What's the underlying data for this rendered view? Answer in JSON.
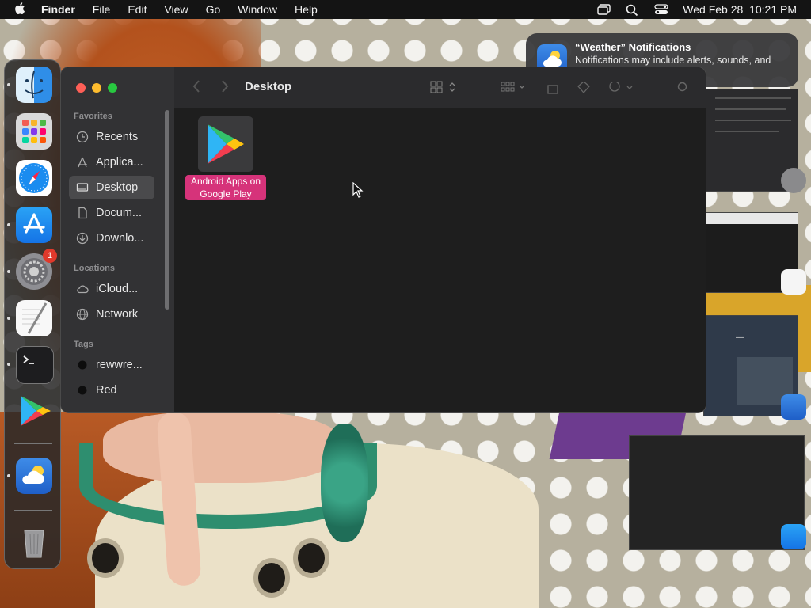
{
  "menubar": {
    "app_name": "Finder",
    "items": [
      "File",
      "Edit",
      "View",
      "Go",
      "Window",
      "Help"
    ],
    "datetime": "Wed Feb 28  10:21 PM"
  },
  "notification": {
    "title": "“Weather” Notifications",
    "body": "Notifications may include alerts, sounds, and icon badges."
  },
  "dock": {
    "apps": [
      {
        "name": "Finder",
        "icon": "finder-icon",
        "running": true
      },
      {
        "name": "Launchpad",
        "icon": "launchpad-icon",
        "running": false
      },
      {
        "name": "Safari",
        "icon": "safari-icon",
        "running": false
      },
      {
        "name": "App Store",
        "icon": "app-store-icon",
        "running": true
      },
      {
        "name": "System Settings",
        "icon": "system-settings-icon",
        "running": true,
        "badge": "1"
      },
      {
        "name": "TextEdit",
        "icon": "textedit-icon",
        "running": true
      },
      {
        "name": "Terminal",
        "icon": "terminal-icon",
        "running": true
      },
      {
        "name": "Google Play",
        "icon": "google-play-icon",
        "running": false
      },
      {
        "name": "Weather",
        "icon": "weather-icon",
        "running": true
      },
      {
        "name": "Trash",
        "icon": "trash-icon",
        "running": false
      }
    ]
  },
  "finder": {
    "title": "Desktop",
    "sidebar": {
      "favorites_header": "Favorites",
      "favorites": [
        {
          "label": "Recents",
          "icon": "clock-icon"
        },
        {
          "label": "Applica...",
          "icon": "applications-icon"
        },
        {
          "label": "Desktop",
          "icon": "desktop-icon",
          "selected": true
        },
        {
          "label": "Docum...",
          "icon": "document-icon"
        },
        {
          "label": "Downlo...",
          "icon": "download-icon"
        }
      ],
      "locations_header": "Locations",
      "locations": [
        {
          "label": "iCloud...",
          "icon": "cloud-icon"
        },
        {
          "label": "Network",
          "icon": "globe-icon"
        }
      ],
      "tags_header": "Tags",
      "tags": [
        {
          "label": "rewwre...",
          "color": "#1a1a1a"
        },
        {
          "label": "Red",
          "color": "#1a1a1a"
        }
      ]
    },
    "files": [
      {
        "label": "Android Apps on Google Play",
        "icon": "google-play-icon"
      }
    ]
  },
  "colors": {
    "selection_label": "#d6337a",
    "badge": "#e0392b",
    "finder_bg": "#1e1e1e"
  }
}
